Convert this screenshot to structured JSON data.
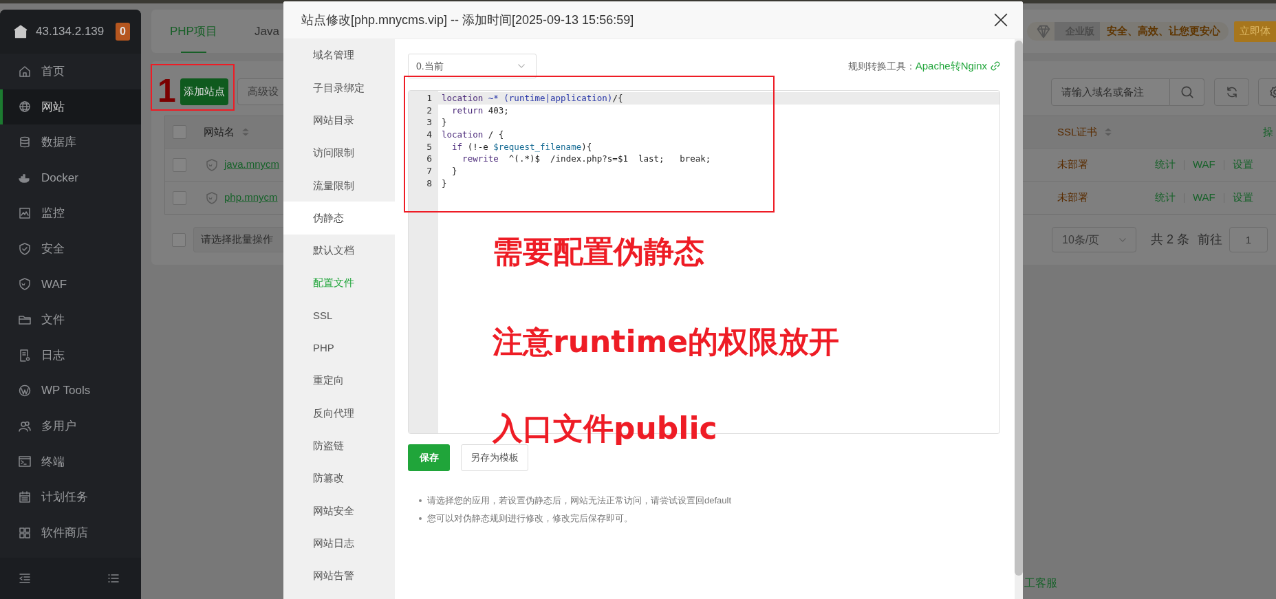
{
  "sidebar": {
    "server_ip": "43.134.2.139",
    "alert_count": "0",
    "items": [
      {
        "label": "首页",
        "selected": false
      },
      {
        "label": "网站",
        "selected": true
      },
      {
        "label": "数据库",
        "selected": false
      },
      {
        "label": "Docker",
        "selected": false
      },
      {
        "label": "监控",
        "selected": false
      },
      {
        "label": "安全",
        "selected": false
      },
      {
        "label": "WAF",
        "selected": false
      },
      {
        "label": "文件",
        "selected": false
      },
      {
        "label": "日志",
        "selected": false
      },
      {
        "label": "WP Tools",
        "selected": false
      },
      {
        "label": "多用户",
        "selected": false
      },
      {
        "label": "终端",
        "selected": false
      },
      {
        "label": "计划任务",
        "selected": false
      },
      {
        "label": "软件商店",
        "selected": false
      }
    ]
  },
  "tabs": [
    {
      "label": "PHP项目",
      "selected": true
    },
    {
      "label": "Java",
      "selected": false
    }
  ],
  "promo": {
    "edition": "企业版",
    "slogan": "安全、高效、让您更安心",
    "button": "立即体"
  },
  "toolbar": {
    "add_button": "添加站点",
    "advanced_button": "高级设",
    "search_placeholder": "请输入域名或备注"
  },
  "table": {
    "columns": {
      "name": "网站名",
      "ssl": "SSL证书",
      "actions": "操"
    },
    "header_checked": false,
    "rows": [
      {
        "name": "java.mnycm",
        "checked": false,
        "ssl": "未部署",
        "actions": [
          "统计",
          "WAF",
          "设置"
        ]
      },
      {
        "name": "php.mnycm",
        "checked": false,
        "ssl": "未部署",
        "actions": [
          "统计",
          "WAF",
          "设置"
        ]
      }
    ]
  },
  "batch": {
    "checked": false,
    "placeholder": "请选择批量操作"
  },
  "pagination": {
    "page_size": "10条/页",
    "total": "共 2 条",
    "goto_label": "前往",
    "page": "1"
  },
  "floating_service": "工客服",
  "modal": {
    "title": "站点修改[php.mnycms.vip] -- 添加时间[2025-09-13 15:56:59]",
    "nav": [
      {
        "label": "域名管理",
        "selected": false,
        "highlighted": false
      },
      {
        "label": "子目录绑定",
        "selected": false,
        "highlighted": false
      },
      {
        "label": "网站目录",
        "selected": false,
        "highlighted": false
      },
      {
        "label": "访问限制",
        "selected": false,
        "highlighted": false
      },
      {
        "label": "流量限制",
        "selected": false,
        "highlighted": false
      },
      {
        "label": "伪静态",
        "selected": true,
        "highlighted": false
      },
      {
        "label": "默认文档",
        "selected": false,
        "highlighted": false
      },
      {
        "label": "配置文件",
        "selected": false,
        "highlighted": true
      },
      {
        "label": "SSL",
        "selected": false,
        "highlighted": false
      },
      {
        "label": "PHP",
        "selected": false,
        "highlighted": false
      },
      {
        "label": "重定向",
        "selected": false,
        "highlighted": false
      },
      {
        "label": "反向代理",
        "selected": false,
        "highlighted": false
      },
      {
        "label": "防盗链",
        "selected": false,
        "highlighted": false
      },
      {
        "label": "防篡改",
        "selected": false,
        "highlighted": false
      },
      {
        "label": "网站安全",
        "selected": false,
        "highlighted": false
      },
      {
        "label": "网站日志",
        "selected": false,
        "highlighted": false
      },
      {
        "label": "网站告警",
        "selected": false,
        "highlighted": false
      }
    ],
    "template_select": "0.当前",
    "converter_label": "规则转换工具：",
    "converter_link": "Apache转Nginx",
    "code_lines": [
      {
        "number": "1",
        "tokens": [
          {
            "kind": "keyword",
            "text": "location"
          },
          {
            "kind": "regex",
            "text": " ~*"
          },
          {
            "kind": "regex",
            "text": " (runtime|application)"
          },
          {
            "kind": "plain",
            "text": "/{"
          }
        ]
      },
      {
        "number": "2",
        "tokens": [
          {
            "kind": "keyword",
            "text": "  return"
          },
          {
            "kind": "plain",
            "text": " 403;"
          }
        ]
      },
      {
        "number": "3",
        "tokens": [
          {
            "kind": "plain",
            "text": "}"
          }
        ]
      },
      {
        "number": "4",
        "tokens": [
          {
            "kind": "keyword",
            "text": "location"
          },
          {
            "kind": "plain",
            "text": " / {"
          }
        ]
      },
      {
        "number": "5",
        "tokens": [
          {
            "kind": "keyword",
            "text": "  if"
          },
          {
            "kind": "plain",
            "text": " (!-e "
          },
          {
            "kind": "variable",
            "text": "$request_filename"
          },
          {
            "kind": "plain",
            "text": "){"
          }
        ]
      },
      {
        "number": "6",
        "tokens": [
          {
            "kind": "keyword",
            "text": "    rewrite"
          },
          {
            "kind": "plain",
            "text": "  ^(.*)$  /index.php?s=$1  last;   break;"
          }
        ]
      },
      {
        "number": "7",
        "tokens": [
          {
            "kind": "plain",
            "text": "  }"
          }
        ]
      },
      {
        "number": "8",
        "tokens": [
          {
            "kind": "plain",
            "text": "}"
          }
        ]
      }
    ],
    "buttons": {
      "save": "保存",
      "save_template": "另存为模板"
    },
    "notes": [
      "请选择您的应用，若设置伪静态后，网站无法正常访问，请尝试设置回default",
      "您可以对伪静态规则进行修改，修改完后保存即可。"
    ]
  },
  "annotations": {
    "step_marker": "1",
    "notes": [
      "需要配置伪静态",
      "注意runtime的权限放开",
      "入口文件public"
    ]
  }
}
